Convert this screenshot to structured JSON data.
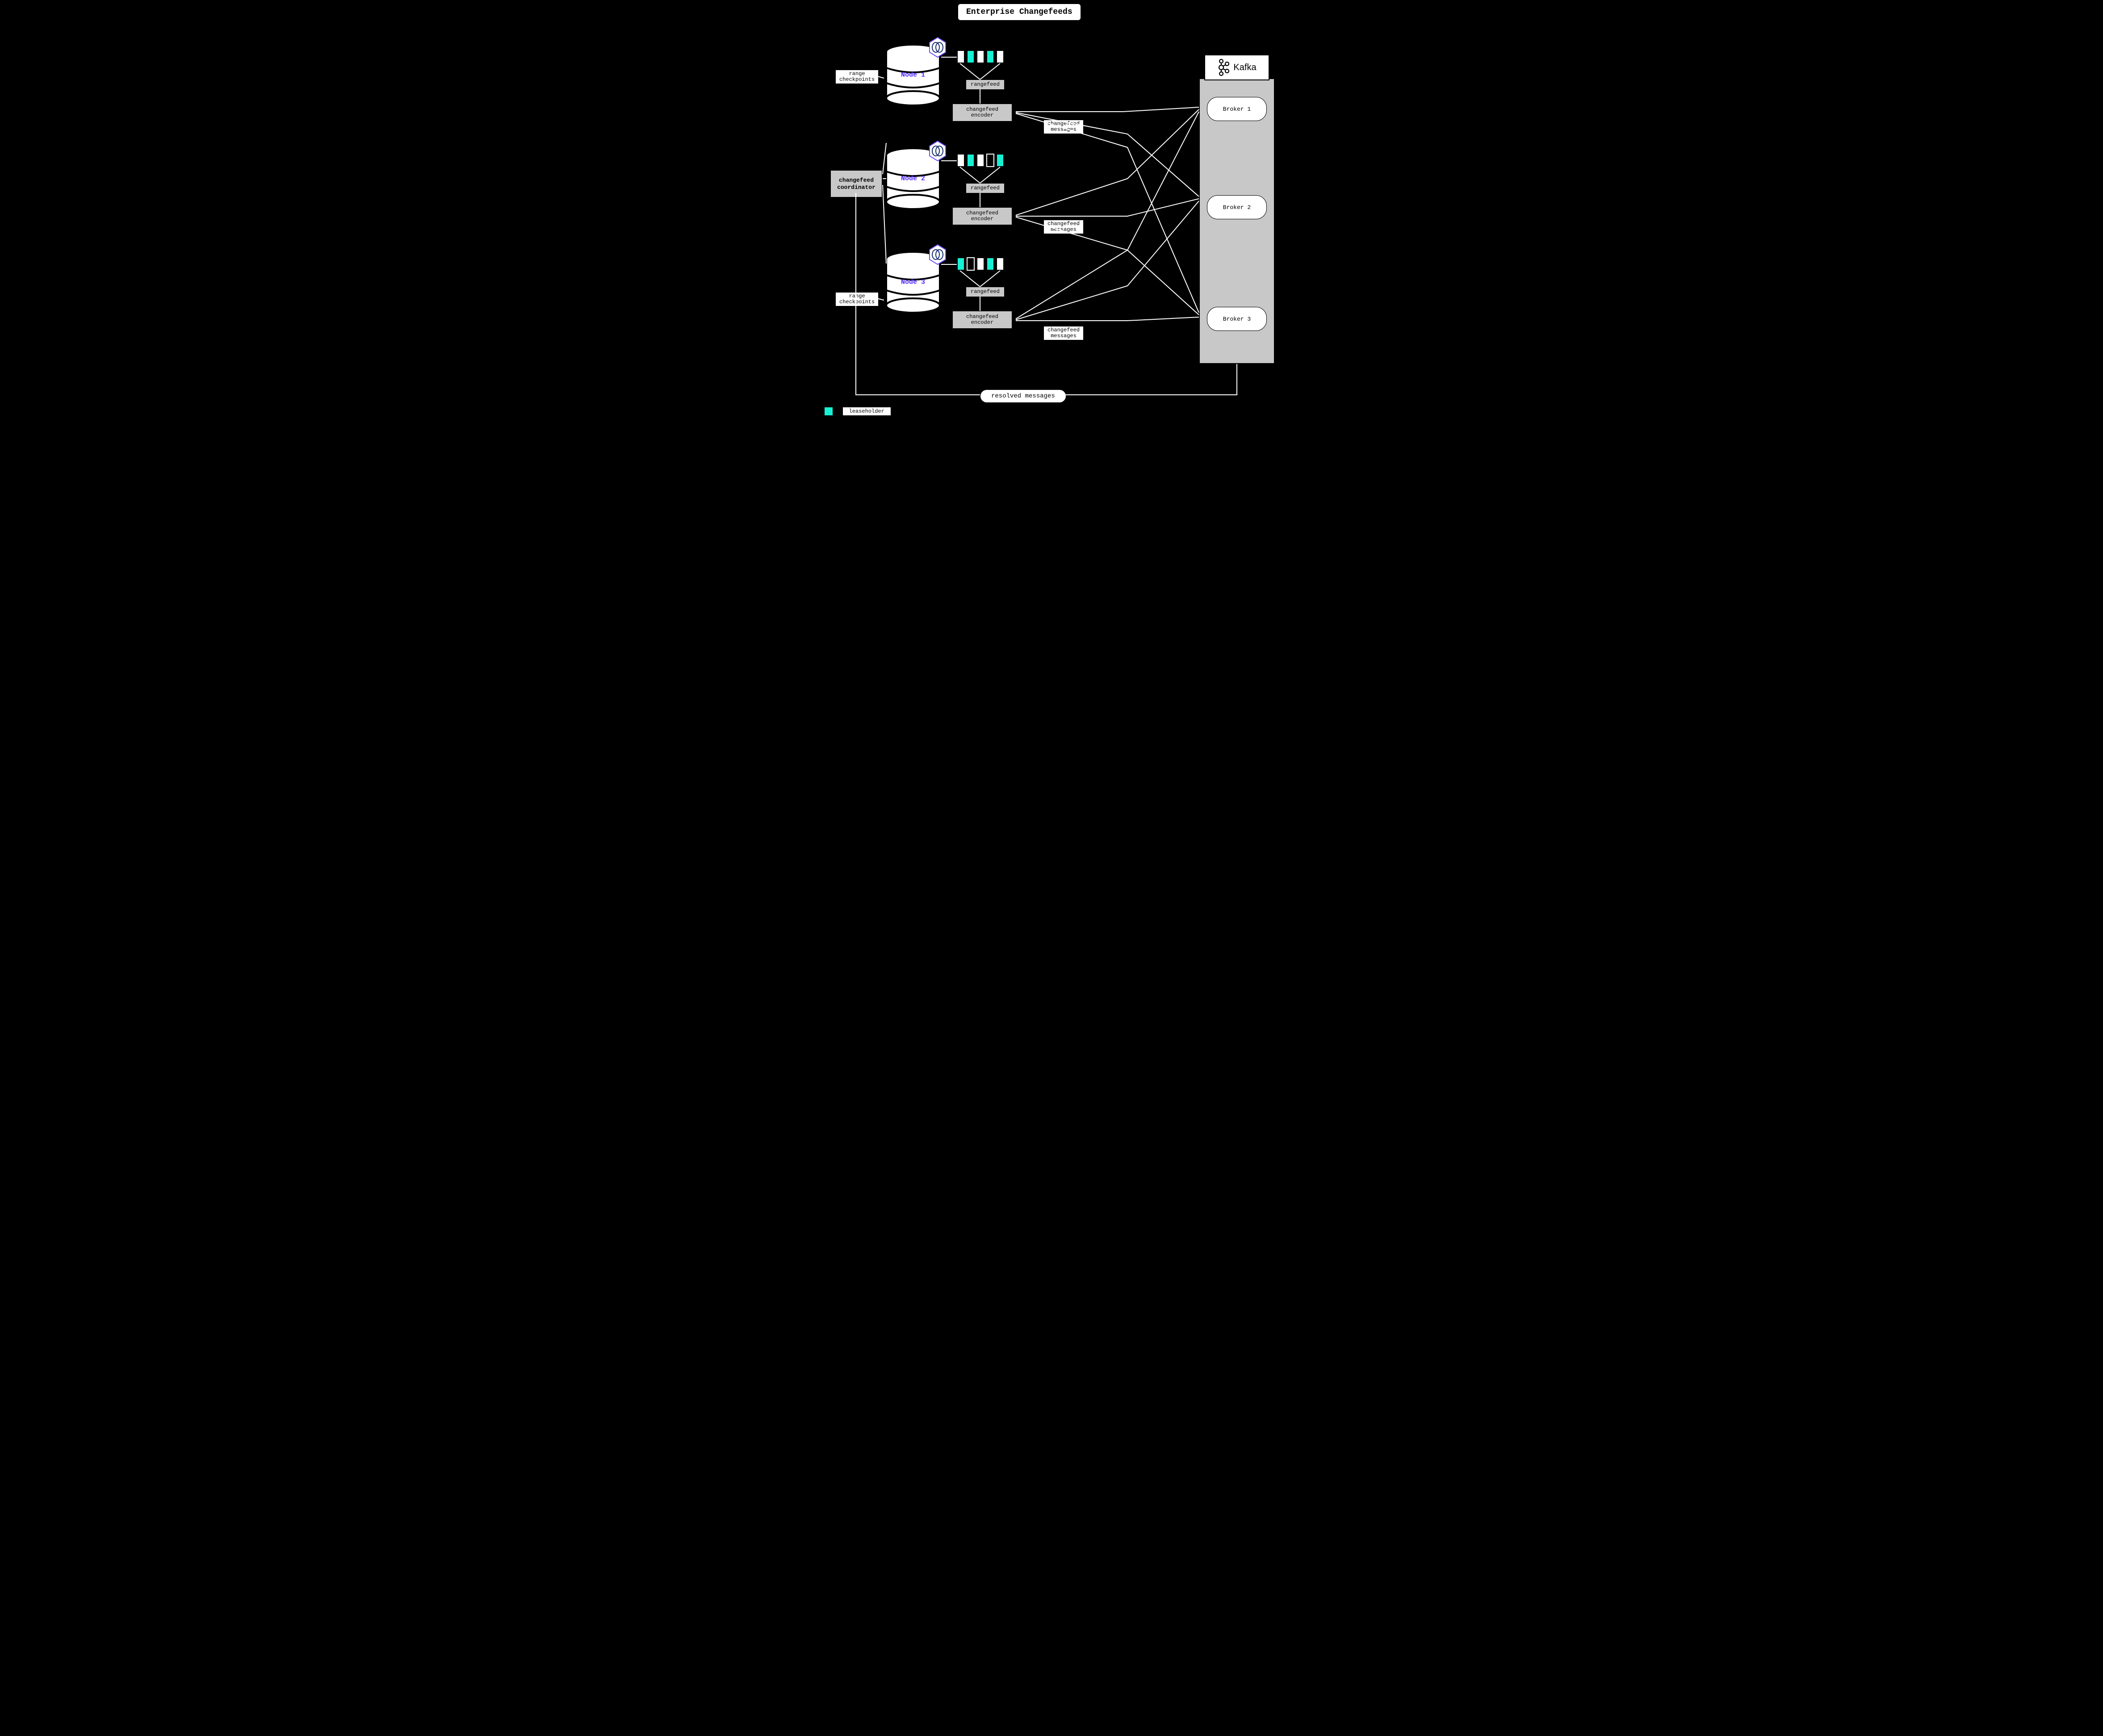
{
  "title": "Enterprise Changefeeds",
  "nodes": [
    {
      "label": "Node 1",
      "side_label": "range\ncheckpoints",
      "ranges": [
        "w",
        "t",
        "w",
        "t",
        "w"
      ]
    },
    {
      "label": "Node 2",
      "side_label": "changefeed\ncoordinator",
      "ranges": [
        "w",
        "t",
        "w",
        "o",
        "t"
      ]
    },
    {
      "label": "Node 3",
      "side_label": "range\ncheckpoints",
      "ranges": [
        "t",
        "o",
        "w",
        "t",
        "w"
      ]
    }
  ],
  "rangefeed_label": "rangefeed",
  "encoder_label": "changefeed\nencoder",
  "messages_label": "changefeed\nmessages",
  "resolved_label": "resolved messages",
  "legend_label": "leaseholder",
  "kafka": {
    "brand": "Kafka",
    "brokers": [
      "Broker 1",
      "Broker 2",
      "Broker 3"
    ]
  },
  "colors": {
    "teal": "#18f0d4",
    "grey": "#c8c8c8",
    "node_text": "#5028ff"
  }
}
